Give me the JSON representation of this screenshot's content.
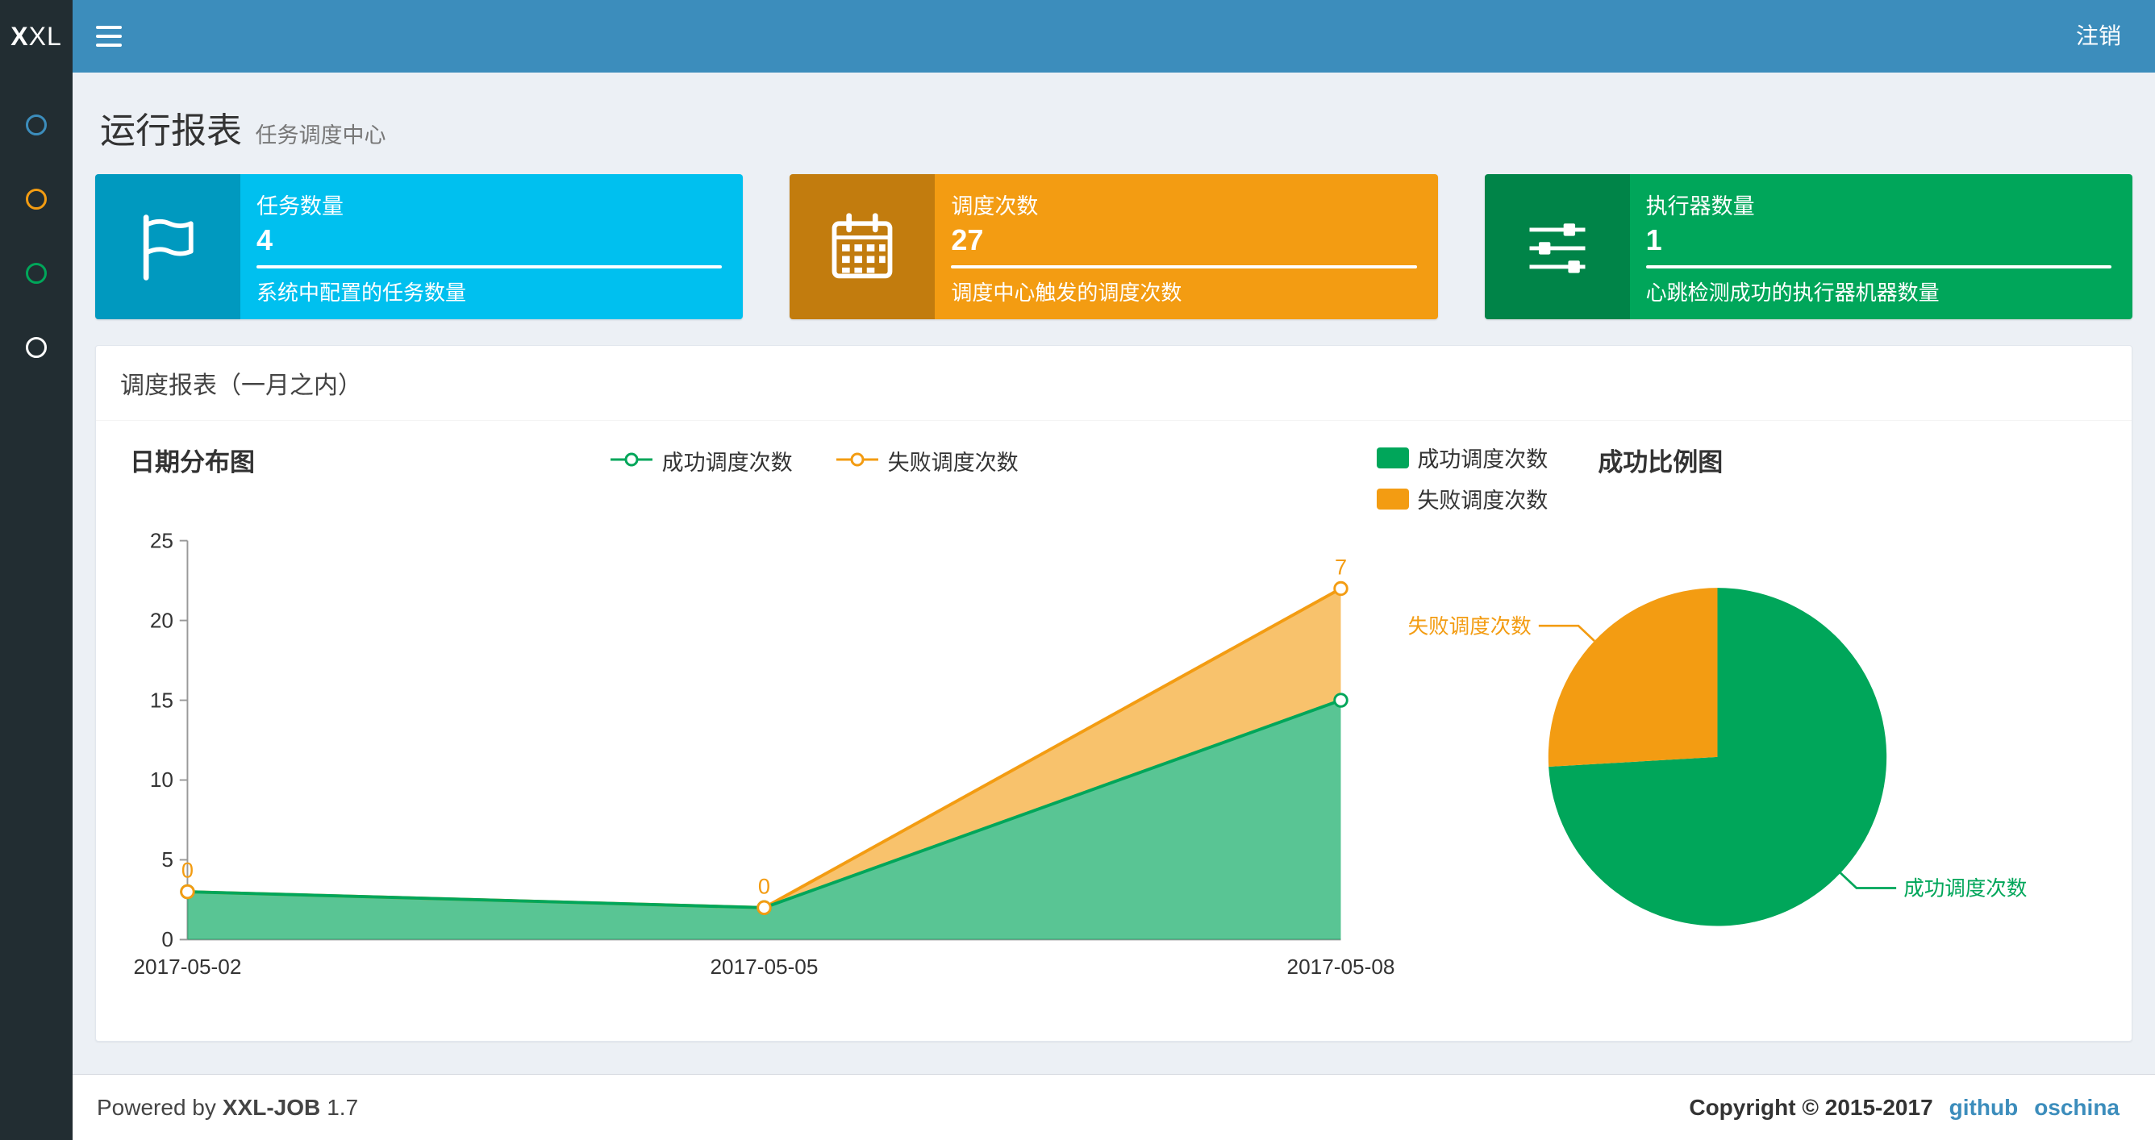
{
  "theme": {
    "navbar_bg": "#3c8dbc",
    "logo_bg": "#222d32",
    "sidebar_bg": "#222d32",
    "content_bg": "#ecf0f5",
    "link_color": "#3c8dbc"
  },
  "navbar": {
    "logo_bold": "X",
    "logo_rest": "XL",
    "logout_label": "注销"
  },
  "sidebar": {
    "items": [
      {
        "name": "menu-item-1",
        "color": "#3c8dbc"
      },
      {
        "name": "menu-item-2",
        "color": "#f39c12"
      },
      {
        "name": "menu-item-3",
        "color": "#00a65a"
      },
      {
        "name": "menu-item-4",
        "color": "#ffffff"
      }
    ]
  },
  "page_header": {
    "title": "运行报表",
    "subtitle": "任务调度中心"
  },
  "info_boxes": [
    {
      "icon": "flag-icon",
      "label": "任务数量",
      "value": "4",
      "description": "系统中配置的任务数量",
      "color": "#00c0ef"
    },
    {
      "icon": "calendar-icon",
      "label": "调度次数",
      "value": "27",
      "description": "调度中心触发的调度次数",
      "color": "#f39c12"
    },
    {
      "icon": "sliders-icon",
      "label": "执行器数量",
      "value": "1",
      "description": "心跳检测成功的执行器机器数量",
      "color": "#00a65a"
    }
  ],
  "panel": {
    "title": "调度报表（一月之内）"
  },
  "chart_data": [
    {
      "type": "area",
      "title": "日期分布图",
      "stacked": true,
      "x": [
        "2017-05-02",
        "2017-05-05",
        "2017-05-08"
      ],
      "series": [
        {
          "name": "成功调度次数",
          "values": [
            3,
            2,
            15
          ],
          "color": "#00a65a"
        },
        {
          "name": "失败调度次数",
          "values": [
            0,
            0,
            7
          ],
          "color": "#f39c12"
        }
      ],
      "point_labels": [
        "0",
        "0",
        "7"
      ],
      "ylim": [
        0,
        25
      ],
      "yticks": [
        0,
        5,
        10,
        15,
        20,
        25
      ],
      "legend_position": "top-center",
      "grid": false
    },
    {
      "type": "pie",
      "title": "成功比例图",
      "slices": [
        {
          "label": "成功调度次数",
          "value": 20,
          "color": "#00a65a"
        },
        {
          "label": "失败调度次数",
          "value": 7,
          "color": "#f39c12"
        }
      ],
      "legend_position": "top-left"
    }
  ],
  "footer": {
    "powered_by": "Powered by",
    "app_name": "XXL-JOB",
    "version": "1.7",
    "copyright": "Copyright © 2015-2017",
    "links": [
      {
        "label": "github"
      },
      {
        "label": "oschina"
      }
    ]
  }
}
